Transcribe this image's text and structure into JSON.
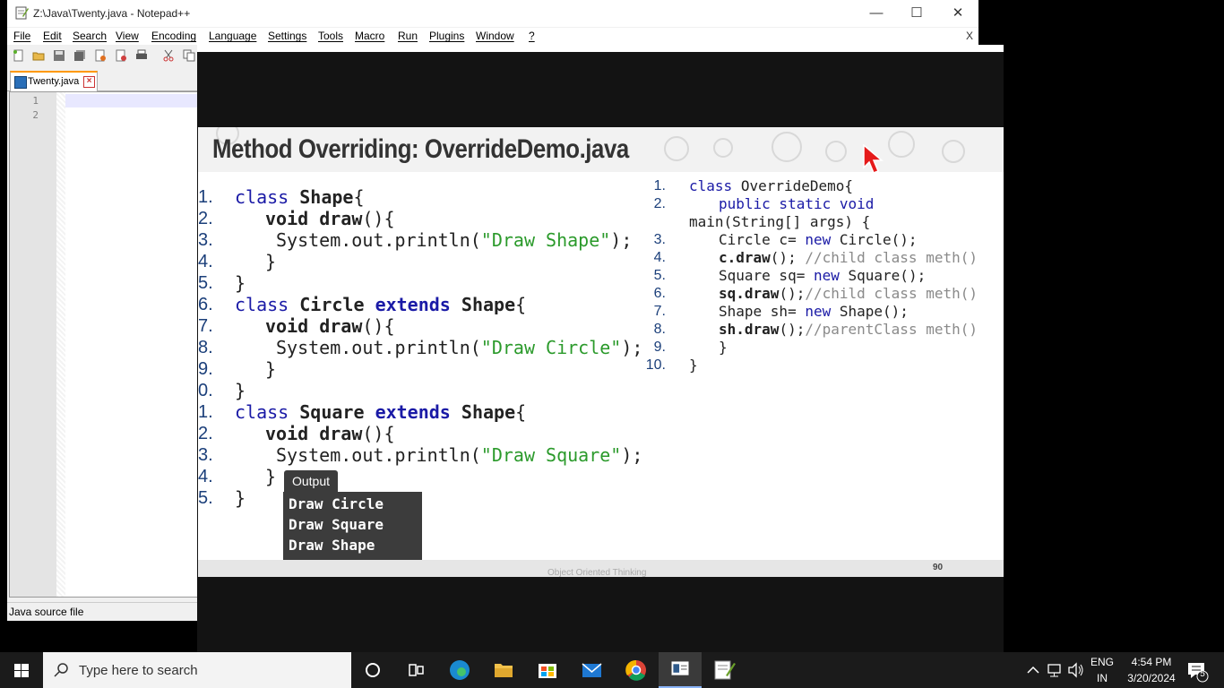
{
  "window": {
    "title": "Z:\\Java\\Twenty.java - Notepad++",
    "minimize": "—",
    "maximize": "☐",
    "close": "✕"
  },
  "menu": {
    "items": [
      "File",
      "Edit",
      "Search",
      "View",
      "Encoding",
      "Language",
      "Settings",
      "Tools",
      "Macro",
      "Run",
      "Plugins",
      "Window",
      "?"
    ],
    "close_label": "X"
  },
  "tab": {
    "label": "Twenty.java"
  },
  "editor": {
    "line_numbers": [
      "1",
      "2"
    ]
  },
  "status": {
    "file_type": "Java source file"
  },
  "slide": {
    "title": "Method Overriding: OverrideDemo.java",
    "left_numbers": [
      "1.",
      "2.",
      "3.",
      "4.",
      "5.",
      "6.",
      "7.",
      "8.",
      "9.",
      "0.",
      "1.",
      "2.",
      "3.",
      "4.",
      "5."
    ],
    "right_numbers": [
      "1.",
      "2.",
      "",
      "3.",
      "4.",
      "5.",
      "6.",
      "7.",
      "8.",
      "9.",
      "10."
    ],
    "output_tab": "Output",
    "output_lines": [
      "Draw Circle",
      "Draw Square",
      "Draw Shape"
    ],
    "footer": "Object Oriented Thinking",
    "page_number": "90"
  },
  "taskbar": {
    "search_placeholder": "Type here to search",
    "lang_line1": "ENG",
    "lang_line2": "IN",
    "time": "4:54 PM",
    "date": "3/20/2024",
    "notification_count": "5"
  }
}
